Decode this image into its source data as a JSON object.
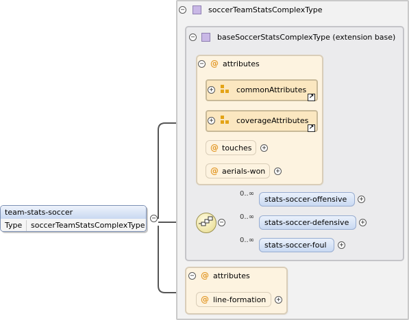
{
  "complex_type": {
    "name": "soccerTeamStatsComplexType"
  },
  "base_type": {
    "name": "baseSoccerStatsComplexType (extension base)"
  },
  "attributes_group": {
    "label": "attributes",
    "groups": [
      "commonAttributes",
      "coverageAttributes"
    ],
    "attributes": [
      "touches",
      "aerials-won"
    ]
  },
  "sequence": {
    "elements": [
      {
        "name": "stats-soccer-offensive",
        "multiplicity": "0..∞"
      },
      {
        "name": "stats-soccer-defensive",
        "multiplicity": "0..∞"
      },
      {
        "name": "stats-soccer-foul",
        "multiplicity": "0..∞"
      }
    ]
  },
  "own_attributes": {
    "label": "attributes",
    "attributes": [
      "line-formation"
    ]
  },
  "root_element": {
    "name": "team-stats-soccer",
    "type_label": "Type",
    "type_value": "soccerTeamStatsComplexType"
  },
  "icons": {
    "collapse": "⊖",
    "expand": "⊕",
    "attribute": "@",
    "link": "↗"
  },
  "colors": {
    "complex_type_bg": "#f2f2f2",
    "attribute_bg": "#fdf3e0",
    "element_fill": "#c9d9f2",
    "connector": "#555555"
  }
}
